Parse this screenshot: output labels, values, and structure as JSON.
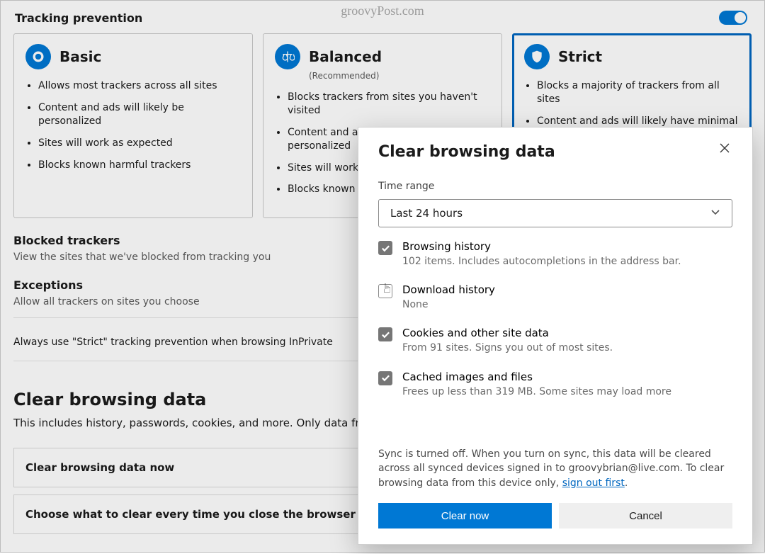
{
  "watermark": "groovyPost.com",
  "tracking": {
    "heading": "Tracking prevention",
    "cards": {
      "basic": {
        "title": "Basic",
        "bullets": [
          "Allows most trackers across all sites",
          "Content and ads will likely be personalized",
          "Sites will work as expected",
          "Blocks known harmful trackers"
        ]
      },
      "balanced": {
        "title": "Balanced",
        "sub": "(Recommended)",
        "bullets": [
          "Blocks trackers from sites you haven't visited",
          "Content and ads will likely be less personalized",
          "Sites will work as expected",
          "Blocks known harmful trackers"
        ]
      },
      "strict": {
        "title": "Strict",
        "bullets": [
          "Blocks a majority of trackers from all sites",
          "Content and ads will likely have minimal personalization"
        ]
      }
    },
    "blocked_heading": "Blocked trackers",
    "blocked_desc": "View the sites that we've blocked from tracking you",
    "exceptions_heading": "Exceptions",
    "exceptions_desc": "Allow all trackers on sites you choose",
    "inprivate_row": "Always use \"Strict\" tracking prevention when browsing InPrivate"
  },
  "clear_section": {
    "heading": "Clear browsing data",
    "desc": "This includes history, passwords, cookies, and more. Only data from th",
    "row1": "Clear browsing data now",
    "row2": "Choose what to clear every time you close the browser"
  },
  "dialog": {
    "title": "Clear browsing data",
    "time_label": "Time range",
    "time_value": "Last 24 hours",
    "items": [
      {
        "title": "Browsing history",
        "desc": "102 items. Includes autocompletions in the address bar.",
        "checked": true
      },
      {
        "title": "Download history",
        "desc": "None",
        "checked": false
      },
      {
        "title": "Cookies and other site data",
        "desc": "From 91 sites. Signs you out of most sites.",
        "checked": true
      },
      {
        "title": "Cached images and files",
        "desc": "Frees up less than 319 MB. Some sites may load more",
        "checked": true
      }
    ],
    "sync_note_1": "Sync is turned off. When you turn on sync, this data will be cleared across all synced devices signed in to groovybrian@live.com. To clear browsing data from this device only, ",
    "sync_link": "sign out first",
    "sync_note_2": ".",
    "primary": "Clear now",
    "secondary": "Cancel"
  }
}
